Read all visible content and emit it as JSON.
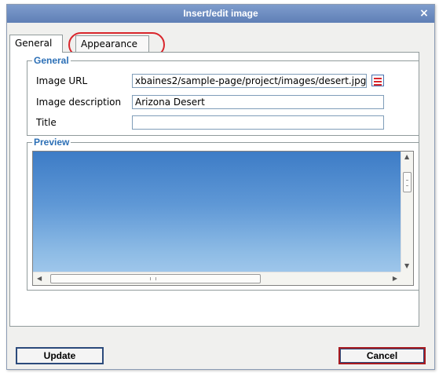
{
  "dialog": {
    "title": "Insert/edit image",
    "close_glyph": "×"
  },
  "tabs": [
    {
      "label": "General",
      "active": true
    },
    {
      "label": "Appearance",
      "active": false
    }
  ],
  "general": {
    "legend": "General",
    "fields": {
      "image_url": {
        "label": "Image URL",
        "value": "xbaines2/sample-page/project/images/desert.jpg"
      },
      "image_description": {
        "label": "Image description",
        "value": "Arizona Desert"
      },
      "title": {
        "label": "Title",
        "value": ""
      }
    },
    "browse_icon": "browse-icon"
  },
  "preview": {
    "legend": "Preview",
    "scroll_arrows": {
      "up": "▲",
      "down": "▼",
      "left": "◀",
      "right": "▶"
    }
  },
  "buttons": {
    "update": "Update",
    "cancel": "Cancel"
  },
  "colors": {
    "titlebar": "#6a89bf",
    "legend": "#2b6fb6",
    "highlight": "#d9262c"
  }
}
